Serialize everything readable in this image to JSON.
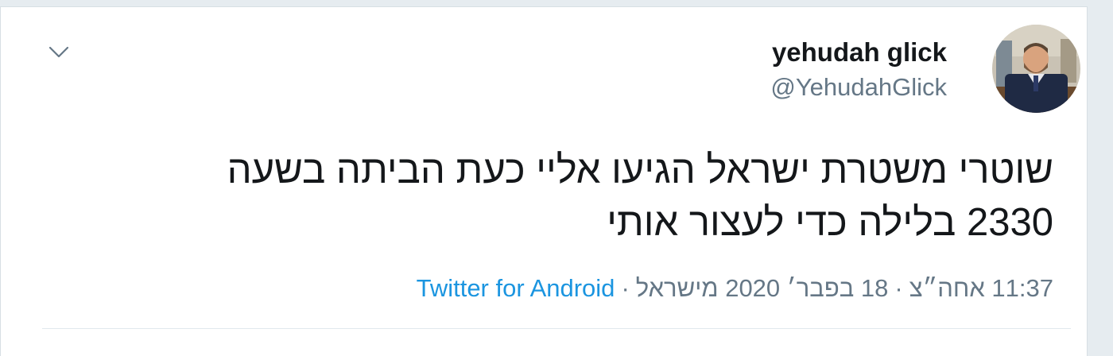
{
  "tweet": {
    "author": {
      "display_name": "yehudah glick",
      "handle": "@YehudahGlick",
      "avatar_icon": "profile-photo"
    },
    "text_lines": [
      "שוטרי משטרת ישראל הגיעו אליי כעת הביתה בשעה",
      "2330 בלילה כדי לעצור אותי"
    ],
    "timestamp": "11:37 אחה״צ",
    "date": "18 בפבר׳ 2020",
    "location": "מישראל",
    "source": "Twitter for Android",
    "separator": "·",
    "menu_icon": "chevron-down-icon"
  },
  "colors": {
    "text": "#14171a",
    "muted": "#657786",
    "link": "#1b95e0",
    "border": "#e1e8ed",
    "background": "#e6ecf0"
  }
}
